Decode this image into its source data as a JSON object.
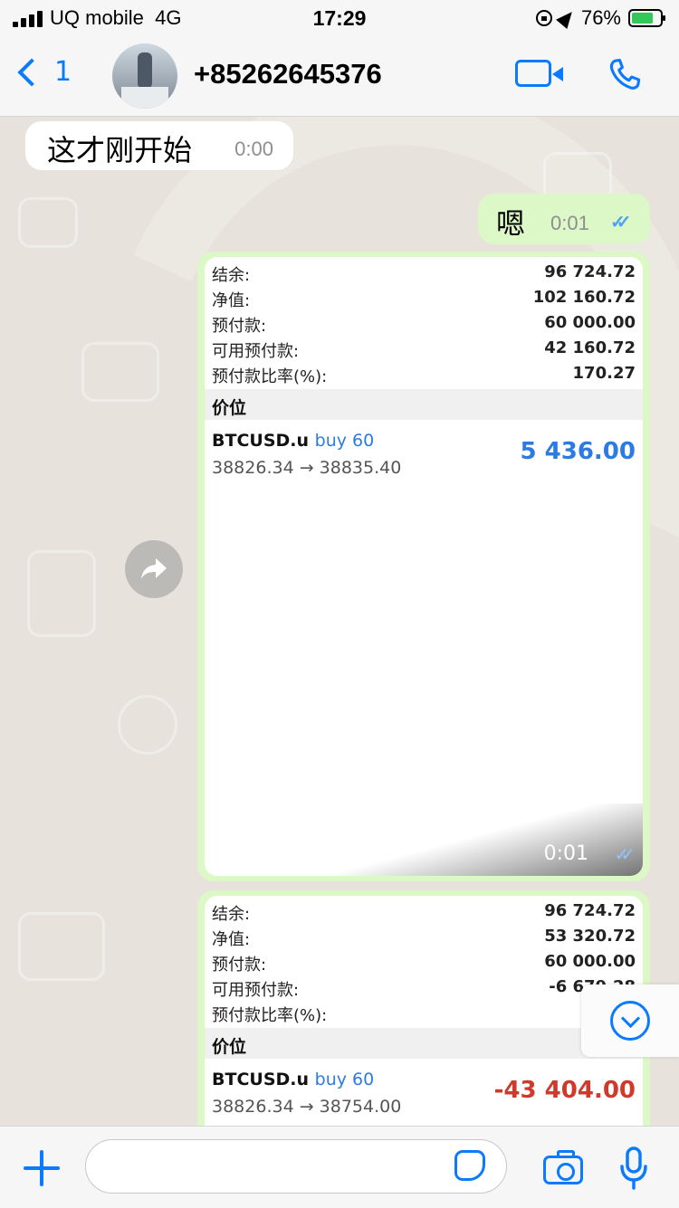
{
  "status_bar": {
    "carrier": "UQ mobile",
    "network": "4G",
    "time": "17:29",
    "battery": "76%",
    "battery_level": 0.76
  },
  "header": {
    "back_count": "1",
    "contact": "+85262645376",
    "icons": [
      "chevron-left-icon",
      "video-call-icon",
      "phone-icon"
    ]
  },
  "messages": [
    {
      "direction": "incoming",
      "text": "这才刚开始",
      "time": "0:00"
    },
    {
      "direction": "outgoing",
      "text": "嗯",
      "time": "0:01",
      "read": true
    },
    {
      "direction": "outgoing",
      "type": "image",
      "time": "0:01",
      "account": {
        "balance_label": "结余:",
        "balance": "96 724.72",
        "equity_label": "净值:",
        "equity": "102 160.72",
        "margin_label": "预付款:",
        "margin": "60 000.00",
        "free_margin_label": "可用预付款:",
        "free_margin": "42 160.72",
        "margin_level_label": "预付款比率(%):",
        "margin_level": "170.27"
      },
      "section_label": "价位",
      "trade": {
        "symbol": "BTCUSD.u",
        "direction": "buy 60",
        "prices": "38826.34 → 38835.40",
        "profit": "5 436.00",
        "profit_color": "#2c7be5"
      }
    },
    {
      "direction": "outgoing",
      "type": "image",
      "account": {
        "balance_label": "结余:",
        "balance": "96 724.72",
        "equity_label": "净值:",
        "equity": "53 320.72",
        "margin_label": "预付款:",
        "margin": "60 000.00",
        "free_margin_label": "可用预付款:",
        "free_margin": "-6 679.28",
        "margin_level_label": "预付款比率(%):",
        "margin_level": ""
      },
      "section_label": "价位",
      "trade": {
        "symbol": "BTCUSD.u",
        "direction": "buy 60",
        "prices": "38826.34 → 38754.00",
        "profit": "-43 404.00",
        "profit_color": "#d0392b"
      }
    }
  ],
  "colors": {
    "accent": "#0a7bff",
    "outgoing_bubble": "#dcf8c6",
    "incoming_bubble": "#ffffff"
  }
}
